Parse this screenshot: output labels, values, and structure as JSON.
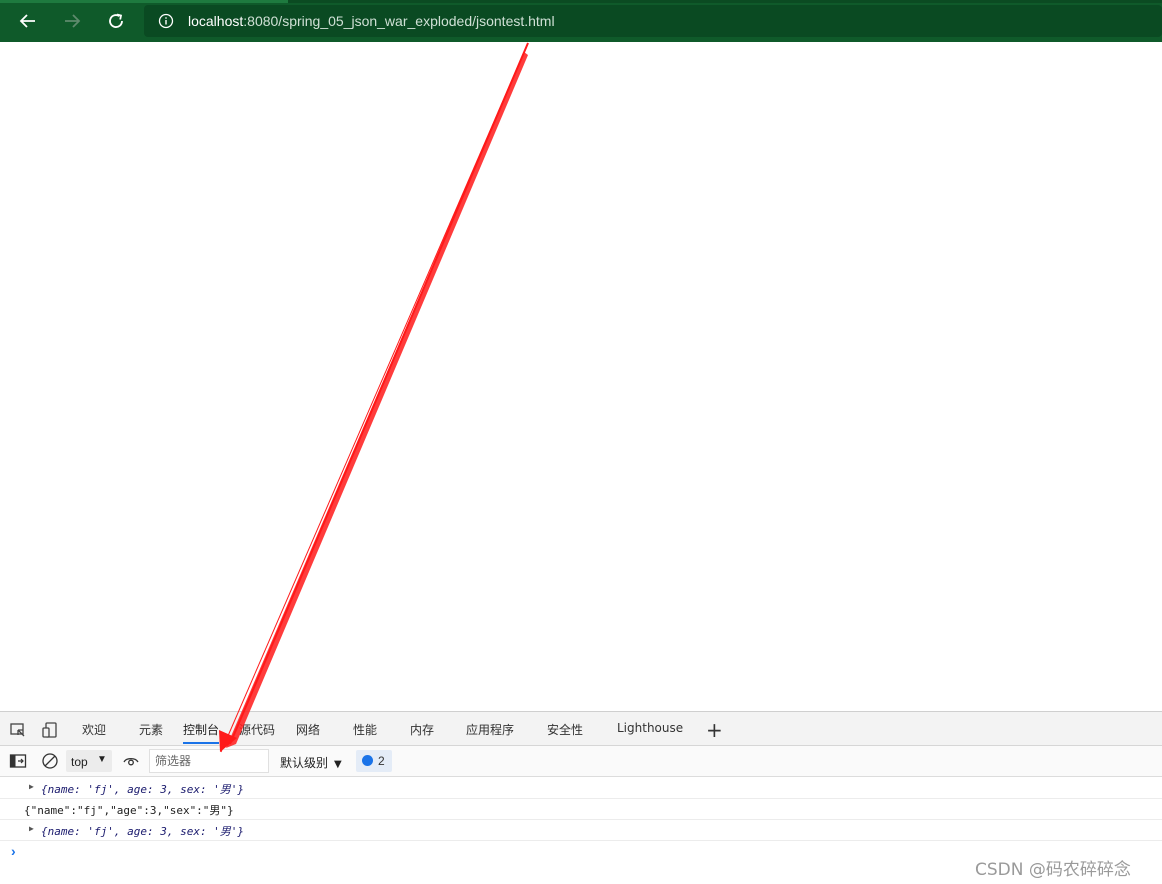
{
  "browser": {
    "url_host": "localhost",
    "url_rest": ":8080/spring_05_json_war_exploded/jsontest.html",
    "accent": "#0f5a2a"
  },
  "devtools": {
    "tabs": [
      "欢迎",
      "元素",
      "控制台",
      "源代码",
      "网络",
      "性能",
      "内存",
      "应用程序",
      "安全性",
      "Lighthouse"
    ],
    "active_tab": "控制台",
    "context": "top",
    "filter_placeholder": "筛选器",
    "level": "默认级别",
    "message_count": "2",
    "console_lines": [
      {
        "type": "object",
        "text": "{name: 'fj', age: 3, sex: '男'}"
      },
      {
        "type": "string",
        "text": "{\"name\":\"fj\",\"age\":3,\"sex\":\"男\"}"
      },
      {
        "type": "object",
        "text": "{name: 'fj', age: 3, sex: '男'}"
      }
    ]
  },
  "watermark": "CSDN @码农碎碎念",
  "annotation_color": "#ff1a1a"
}
